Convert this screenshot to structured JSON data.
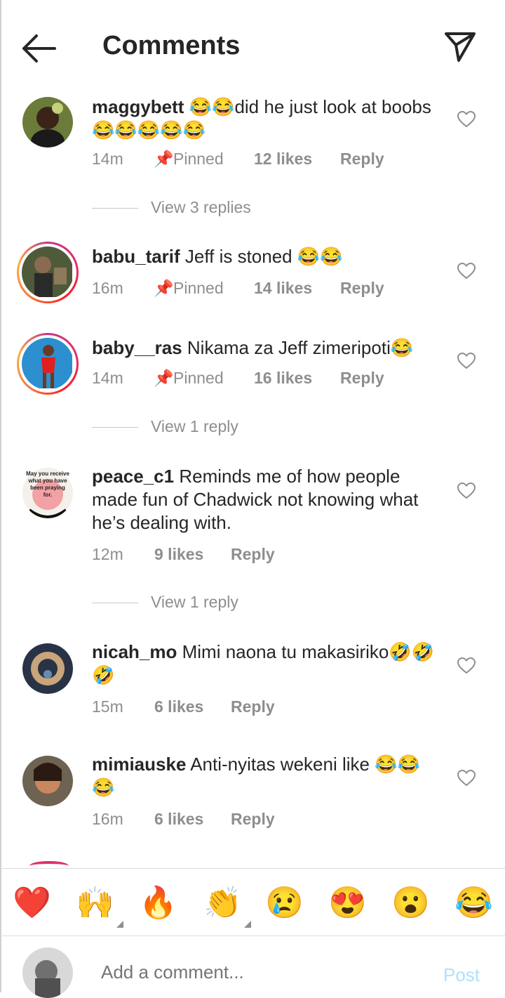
{
  "header": {
    "title": "Comments"
  },
  "comments": [
    {
      "username": "maggybett",
      "text": "😂😂did he just look at boobs😂😂😂😂😂",
      "time": "14m",
      "pinned_label": "Pinned",
      "likes": "12 likes",
      "reply_label": "Reply",
      "view_replies": "View 3 replies"
    },
    {
      "username": "babu_tarif",
      "text": "Jeff is stoned 😂😂",
      "time": "16m",
      "pinned_label": "Pinned",
      "likes": "14 likes",
      "reply_label": "Reply"
    },
    {
      "username": "baby__ras",
      "text": "Nikama za Jeff zimeripoti😂",
      "time": "14m",
      "pinned_label": "Pinned",
      "likes": "16 likes",
      "reply_label": "Reply",
      "view_replies": "View 1 reply"
    },
    {
      "username": "peace_c1",
      "text": "Reminds me of how people made fun of Chadwick not knowing what he’s dealing with.",
      "time": "12m",
      "likes": "9 likes",
      "reply_label": "Reply",
      "view_replies": "View 1 reply",
      "avatar_text": "May you receive what you have been praying for."
    },
    {
      "username": "nicah_mo",
      "text": "Mimi naona tu makasiriko🤣🤣🤣",
      "time": "15m",
      "likes": "6 likes",
      "reply_label": "Reply"
    },
    {
      "username": "mimiauske",
      "text": "Anti-nyitas wekeni like 😂😂😂",
      "time": "16m",
      "likes": "6 likes",
      "reply_label": "Reply"
    }
  ],
  "emoji_bar": [
    "❤️",
    "🙌",
    "🔥",
    "👏",
    "😢",
    "😍",
    "😮",
    "😂"
  ],
  "composer": {
    "placeholder": "Add a comment...",
    "post_label": "Post"
  },
  "colors": {
    "text": "#262626",
    "secondary": "#8e8e8e",
    "post_disabled": "#b2dffc"
  }
}
